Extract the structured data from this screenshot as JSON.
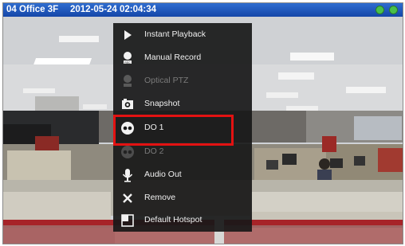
{
  "titlebar": {
    "camera_name": "04 Office 3F",
    "timestamp": "2012-05-24 02:04:34",
    "status_colors": [
      "#49c04a",
      "#49c04a"
    ]
  },
  "menu": {
    "items": [
      {
        "label": "Instant Playback",
        "icon": "play-icon",
        "enabled": true
      },
      {
        "label": "Manual Record",
        "icon": "record-icon",
        "enabled": true
      },
      {
        "label": "Optical PTZ",
        "icon": "ptz-icon",
        "enabled": false
      },
      {
        "label": "Snapshot",
        "icon": "camera-icon",
        "enabled": true
      },
      {
        "label": "DO 1",
        "icon": "digital-output-icon",
        "enabled": true,
        "highlighted": true
      },
      {
        "label": "DO 2",
        "icon": "digital-output-icon",
        "enabled": false
      },
      {
        "label": "Audio Out",
        "icon": "microphone-icon",
        "enabled": true
      },
      {
        "label": "Remove",
        "icon": "close-icon",
        "enabled": true
      },
      {
        "label": "Default Hotspot",
        "icon": "hotspot-icon",
        "enabled": true
      }
    ]
  },
  "colors": {
    "highlight": "#e31212",
    "titlebar": "#1f55bc",
    "menu_bg": "#181818"
  }
}
